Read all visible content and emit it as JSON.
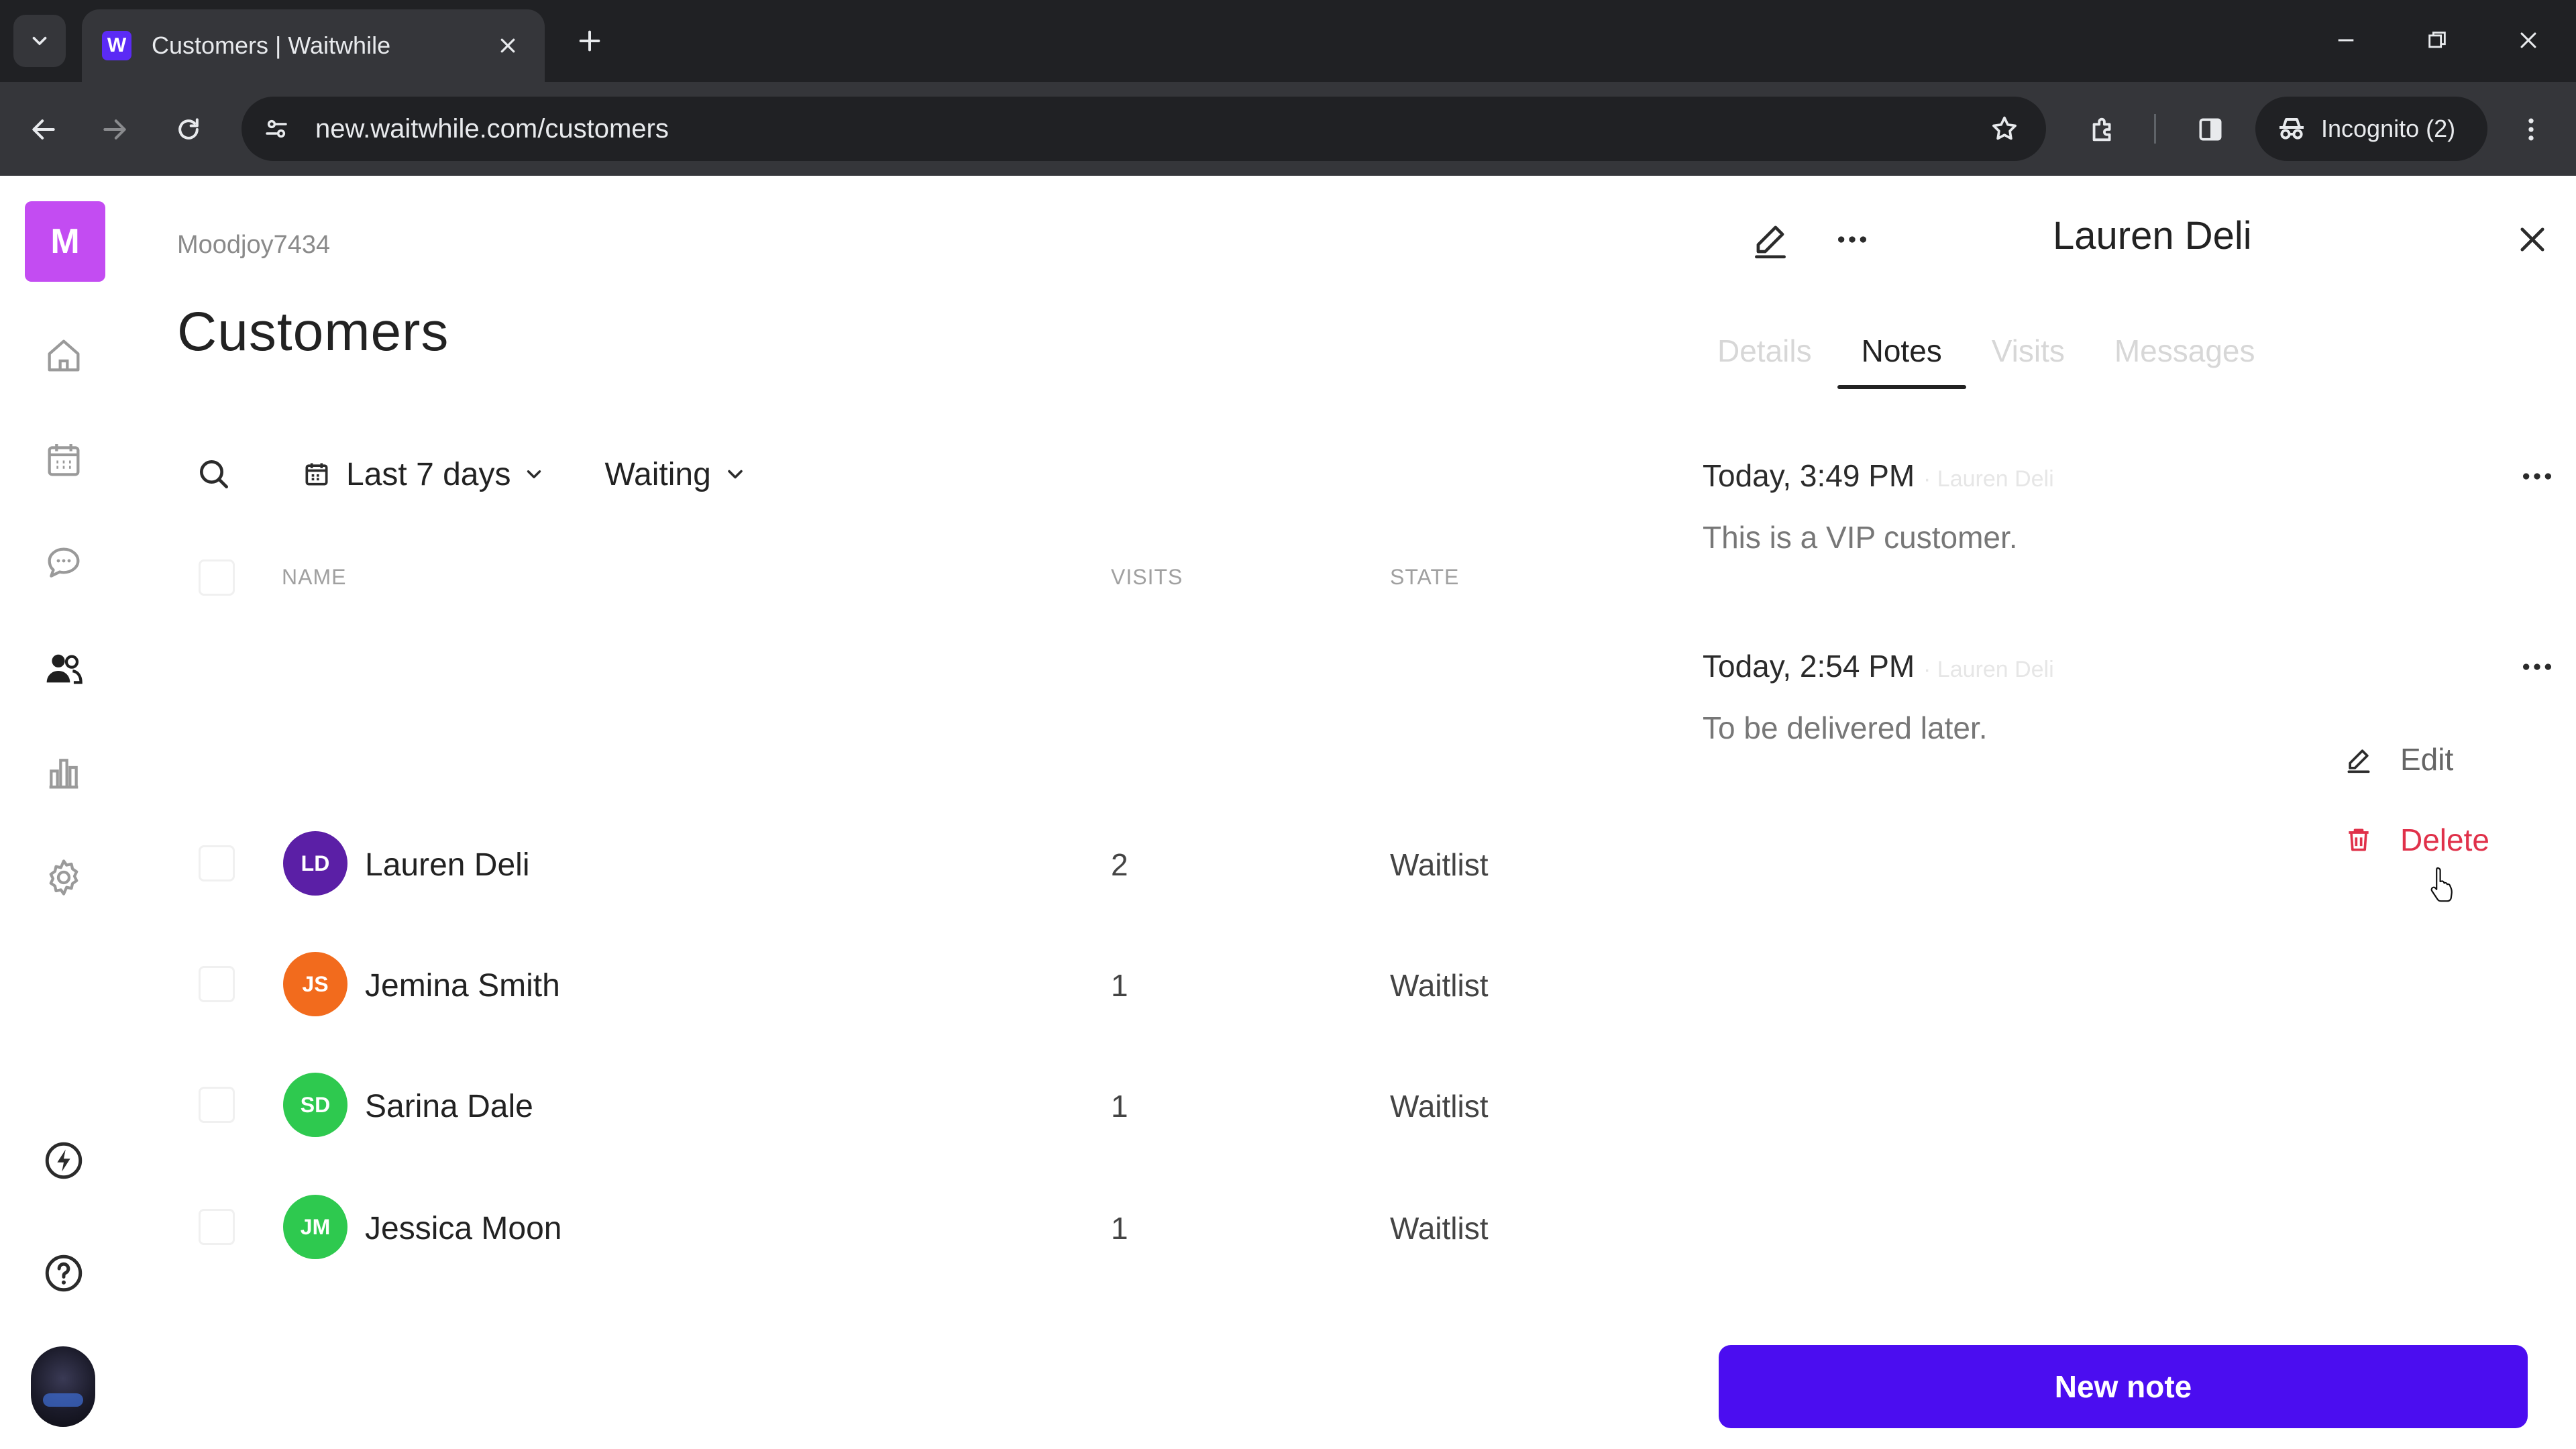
{
  "browser": {
    "tab_title": "Customers | Waitwhile",
    "url": "new.waitwhile.com/customers",
    "incognito_label": "Incognito (2)"
  },
  "sidebar": {
    "org_initial": "M",
    "items": [
      {
        "icon": "home-icon"
      },
      {
        "icon": "calendar-icon"
      },
      {
        "icon": "chat-icon"
      },
      {
        "icon": "customers-icon"
      },
      {
        "icon": "analytics-icon"
      },
      {
        "icon": "settings-icon"
      },
      {
        "icon": "lightning-icon"
      },
      {
        "icon": "help-icon"
      }
    ]
  },
  "main": {
    "account": "Moodjoy7434",
    "title": "Customers",
    "filters": {
      "date_range": "Last 7 days",
      "state": "Waiting"
    },
    "table": {
      "headers": {
        "name": "NAME",
        "visits": "VISITS",
        "state": "STATE"
      },
      "rows": [
        {
          "initials": "LD",
          "name": "Lauren Deli",
          "visits": "2",
          "state": "Waitlist",
          "color": "#5b1fa6"
        },
        {
          "initials": "JS",
          "name": "Jemina Smith",
          "visits": "1",
          "state": "Waitlist",
          "color": "#f26b1d"
        },
        {
          "initials": "SD",
          "name": "Sarina Dale",
          "visits": "1",
          "state": "Waitlist",
          "color": "#2ec94f"
        },
        {
          "initials": "JM",
          "name": "Jessica Moon",
          "visits": "1",
          "state": "Waitlist",
          "color": "#2ec94f"
        }
      ]
    }
  },
  "panel": {
    "title": "Lauren Deli",
    "tabs": [
      "Details",
      "Notes",
      "Visits",
      "Messages"
    ],
    "active_tab": "Notes",
    "notes": [
      {
        "time": "Today, 3:49 PM",
        "author": "Lauren Deli",
        "text": "This is a VIP customer."
      },
      {
        "time": "Today, 2:54 PM",
        "author": "Lauren Deli",
        "text": "To be delivered later."
      }
    ],
    "menu": {
      "edit": "Edit",
      "delete": "Delete"
    },
    "new_note_label": "New note"
  },
  "colors": {
    "accent": "#4b0df0",
    "org_avatar": "#c34cf2",
    "danger": "#e0314a"
  }
}
